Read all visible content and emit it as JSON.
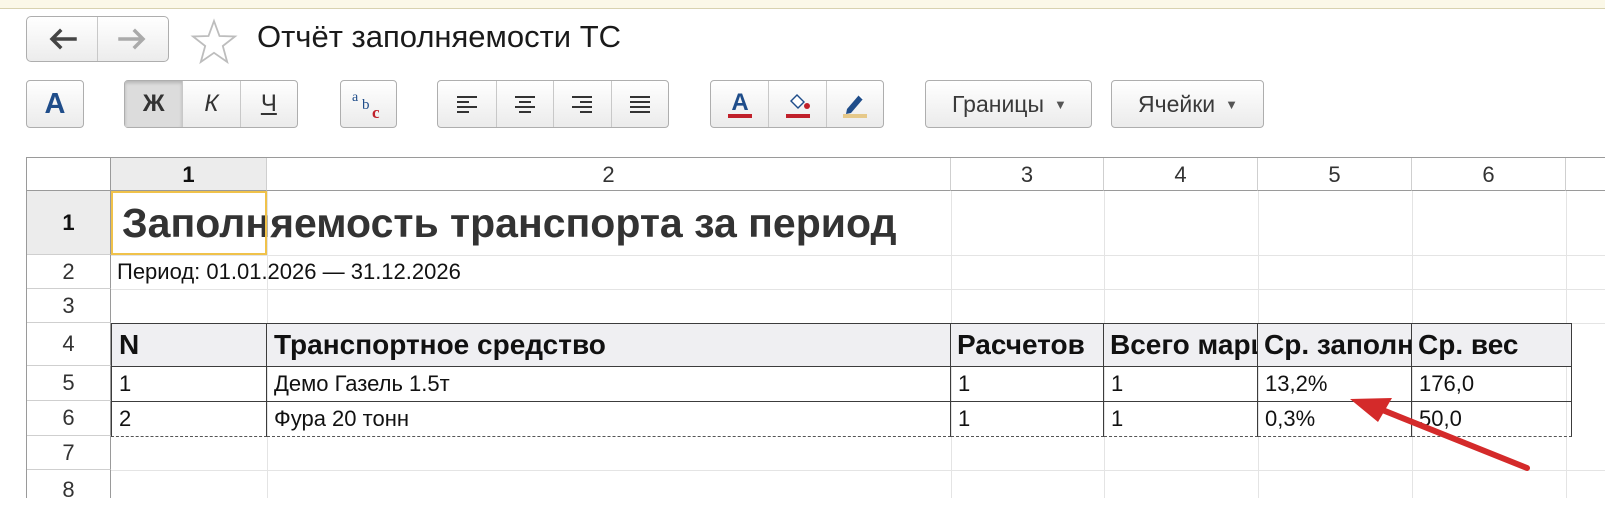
{
  "window": {
    "title": "Отчёт заполняемости ТС"
  },
  "nav": {
    "back_icon": "arrow-left-icon",
    "forward_icon": "arrow-right-icon",
    "back_glyph": "🡐",
    "forward_glyph": "🡒"
  },
  "toolbar": {
    "font_label": "A",
    "bold_label": "Ж",
    "italic_label": "К",
    "underline_label": "Ч",
    "borders_label": "Границы",
    "cells_label": "Ячейки",
    "colors": {
      "text": "#c0202a",
      "fill": "#c0202a",
      "accent": "#1f4d8a"
    }
  },
  "sheet": {
    "columns": [
      "1",
      "2",
      "3",
      "4",
      "5",
      "6"
    ],
    "rows": [
      "1",
      "2",
      "3",
      "4",
      "5",
      "6",
      "7",
      "8"
    ],
    "report_title": "Заполняемость транспорта за период",
    "period": "Период: 01.01.2026 — 31.12.2026",
    "header": [
      "N",
      "Транспортное средство",
      "Расчетов",
      "Всего маршрутов",
      "Ср. заполняемость",
      "Ср. вес"
    ],
    "data": [
      [
        "1",
        "Демо Газель 1.5т",
        "1",
        "1",
        "13,2%",
        "176,0"
      ],
      [
        "2",
        "Фура 20 тонн",
        "1",
        "1",
        "0,3%",
        "50,0"
      ]
    ]
  },
  "annotation": {
    "arrow_color": "#d42a2a"
  }
}
